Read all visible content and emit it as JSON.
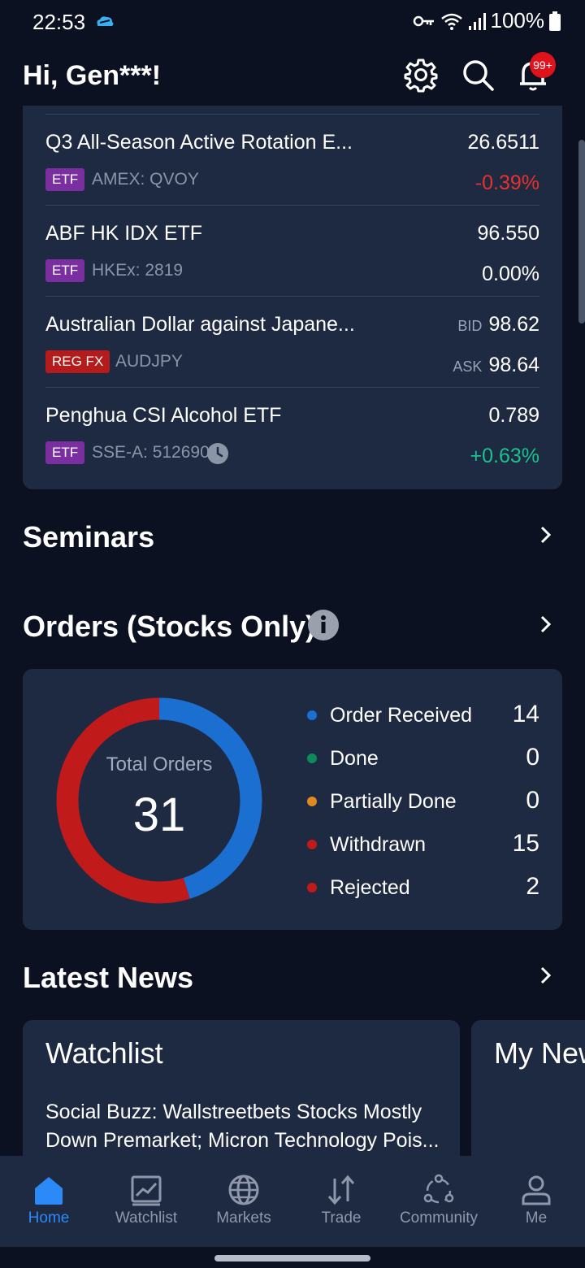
{
  "status_bar": {
    "time": "22:53",
    "battery": "100%",
    "icons": [
      "cloud-icon",
      "key-icon",
      "wifi-icon",
      "signal-icon",
      "battery-icon"
    ]
  },
  "header": {
    "greeting": "Hi, Gen***!",
    "notification_badge": "99+",
    "icons": [
      "gear-icon",
      "search-icon",
      "bell-icon"
    ]
  },
  "watchlist": [
    {
      "name": "Q3 All-Season Active Rotation E...",
      "tag": "ETF",
      "code": "AMEX: QVOY",
      "price": "26.6511",
      "change": "-0.39%",
      "change_color": "#e6322b"
    },
    {
      "name": "ABF HK IDX ETF",
      "tag": "ETF",
      "code": "HKEx: 2819",
      "price": "96.550",
      "change": "0.00%",
      "change_color": "#ffffff"
    },
    {
      "name": "Australian Dollar against Japane...",
      "tag": "REG FX",
      "code": "AUDJPY",
      "bid_label": "BID",
      "bid": "98.62",
      "ask_label": "ASK",
      "ask": "98.64"
    },
    {
      "name": "Penghua CSI Alcohol ETF",
      "tag": "ETF",
      "code": "SSE-A: 512690",
      "price": "0.789",
      "change": "+0.63%",
      "change_color": "#18c38e"
    }
  ],
  "seminars": {
    "title": "Seminars"
  },
  "orders": {
    "title": "Orders (Stocks Only)",
    "total_label": "Total Orders",
    "total": "31",
    "legend": [
      {
        "label": "Order Received",
        "value": "14",
        "color": "#1a6fd1"
      },
      {
        "label": "Done",
        "value": "0",
        "color": "#0e8a5c"
      },
      {
        "label": "Partially Done",
        "value": "0",
        "color": "#e08a1e"
      },
      {
        "label": "Withdrawn",
        "value": "15",
        "color": "#c01a1a"
      },
      {
        "label": "Rejected",
        "value": "2",
        "color": "#c01a1a"
      }
    ]
  },
  "latest_news": {
    "title": "Latest News",
    "cards": [
      {
        "title": "Watchlist",
        "text": "Social Buzz: Wallstreetbets Stocks Mostly Down Premarket; Micron Technology Pois..."
      },
      {
        "title": "My New"
      }
    ]
  },
  "bottom_nav": [
    {
      "label": "Home",
      "icon": "home-icon",
      "active": true
    },
    {
      "label": "Watchlist",
      "icon": "chart-icon"
    },
    {
      "label": "Markets",
      "icon": "globe-icon"
    },
    {
      "label": "Trade",
      "icon": "trade-arrows-icon"
    },
    {
      "label": "Community",
      "icon": "community-icon"
    },
    {
      "label": "Me",
      "icon": "person-icon"
    }
  ],
  "colors": {
    "background": "#0b1120",
    "card": "#1e2942",
    "accent": "#2b8af7",
    "negative": "#e6322b",
    "positive": "#18c38e",
    "etf_tag": "#7a2e9f",
    "fx_tag": "#b51b1b"
  }
}
